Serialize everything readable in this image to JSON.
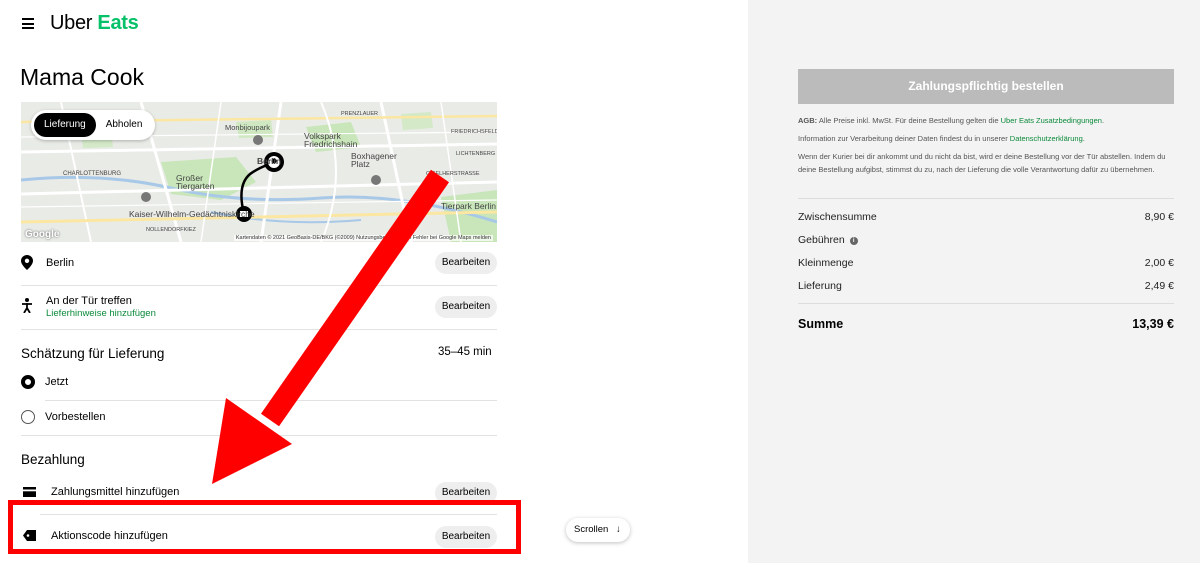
{
  "header": {
    "brand_part1": "Uber",
    "brand_part2": "Eats",
    "menu_icon": "hamburger-menu-icon"
  },
  "store": {
    "name": "Mama Cook"
  },
  "map": {
    "toggle": {
      "delivery": "Lieferung",
      "pickup": "Abholen",
      "selected": "Lieferung"
    },
    "labels": {
      "monbijoupark": "Monbijoupark",
      "volkspark": "Volkspark\nFriedrichshain",
      "boxhagener": "Boxhagener\nPlatz",
      "charlottenburg": "CHARLOTTENBURG",
      "grosser_tiergarten": "Großer\nTiergarten",
      "kaiser_wilhelm": "Kaiser-Wilhelm-Gedächtniskirche",
      "tierpark": "Tierpark Berlin",
      "lichtenberg": "LICHTENBERG",
      "friedrichsfelde": "FRIEDRICHSFELDE",
      "gieselherstrasse": "GISELHERSTRASSE",
      "nollendorfkiez": "NOLLENDORFKIEZ",
      "prenzlauer": "PRENZLAUER",
      "berlin_center": "Berlin",
      "credit": "Kartendaten © 2021 GeoBasis-DE/BKG (©2009)    Nutzungsbedingungen    Fehler bei Google Maps melden",
      "google": "Google"
    }
  },
  "delivery": {
    "address": {
      "label": "Berlin",
      "edit": "Bearbeiten",
      "icon": "location-pin-icon"
    },
    "dropoff": {
      "label": "An der Tür treffen",
      "sub": "Lieferhinweise hinzufügen",
      "edit": "Bearbeiten",
      "icon": "person-walking-icon"
    },
    "estimate": {
      "title": "Schätzung für Lieferung",
      "time": "35–45 min"
    },
    "options": [
      {
        "label": "Jetzt",
        "selected": true
      },
      {
        "label": "Vorbestellen",
        "selected": false
      }
    ]
  },
  "payment": {
    "title": "Bezahlung",
    "method": {
      "label": "Zahlungsmittel hinzufügen",
      "edit": "Bearbeiten",
      "icon": "credit-card-icon"
    },
    "promo": {
      "label": "Aktionscode hinzufügen",
      "edit": "Bearbeiten",
      "icon": "tag-icon"
    }
  },
  "scroll": {
    "label": "Scrollen",
    "icon": "arrow-down-icon"
  },
  "checkout": {
    "order_button": "Zahlungspflichtig bestellen",
    "legal_agb_prefix": "AGB:",
    "legal_agb_text": " Alle Preise inkl. MwSt. Für deine Bestellung gelten die ",
    "legal_agb_link": "Uber Eats Zusatzbedingungen",
    "legal_agb_end": ".",
    "legal_privacy_text": "Information zur Verarbeitung deiner Daten findest du in unserer ",
    "legal_privacy_link": "Datenschutzerklärung",
    "legal_privacy_end": ".",
    "legal_courier": "Wenn der Kurier bei dir ankommt und du nicht da bist, wird er deine Bestellung vor der Tür abstellen. Indem du deine Bestellung aufgibst, stimmst du zu, nach der Lieferung die volle Verantwortung dafür zu übernehmen.",
    "lines": [
      {
        "label": "Zwischensumme",
        "value": "8,90 €"
      },
      {
        "label": "Gebühren",
        "value": ""
      },
      {
        "label": "Kleinmenge",
        "value": "2,00 €"
      },
      {
        "label": "Lieferung",
        "value": "2,49 €"
      }
    ],
    "total": {
      "label": "Summe",
      "value": "13,39 €"
    }
  },
  "colors": {
    "brand_green": "#06c167",
    "annotation_red": "#ff0000",
    "disabled_button": "#bbbbbb"
  }
}
